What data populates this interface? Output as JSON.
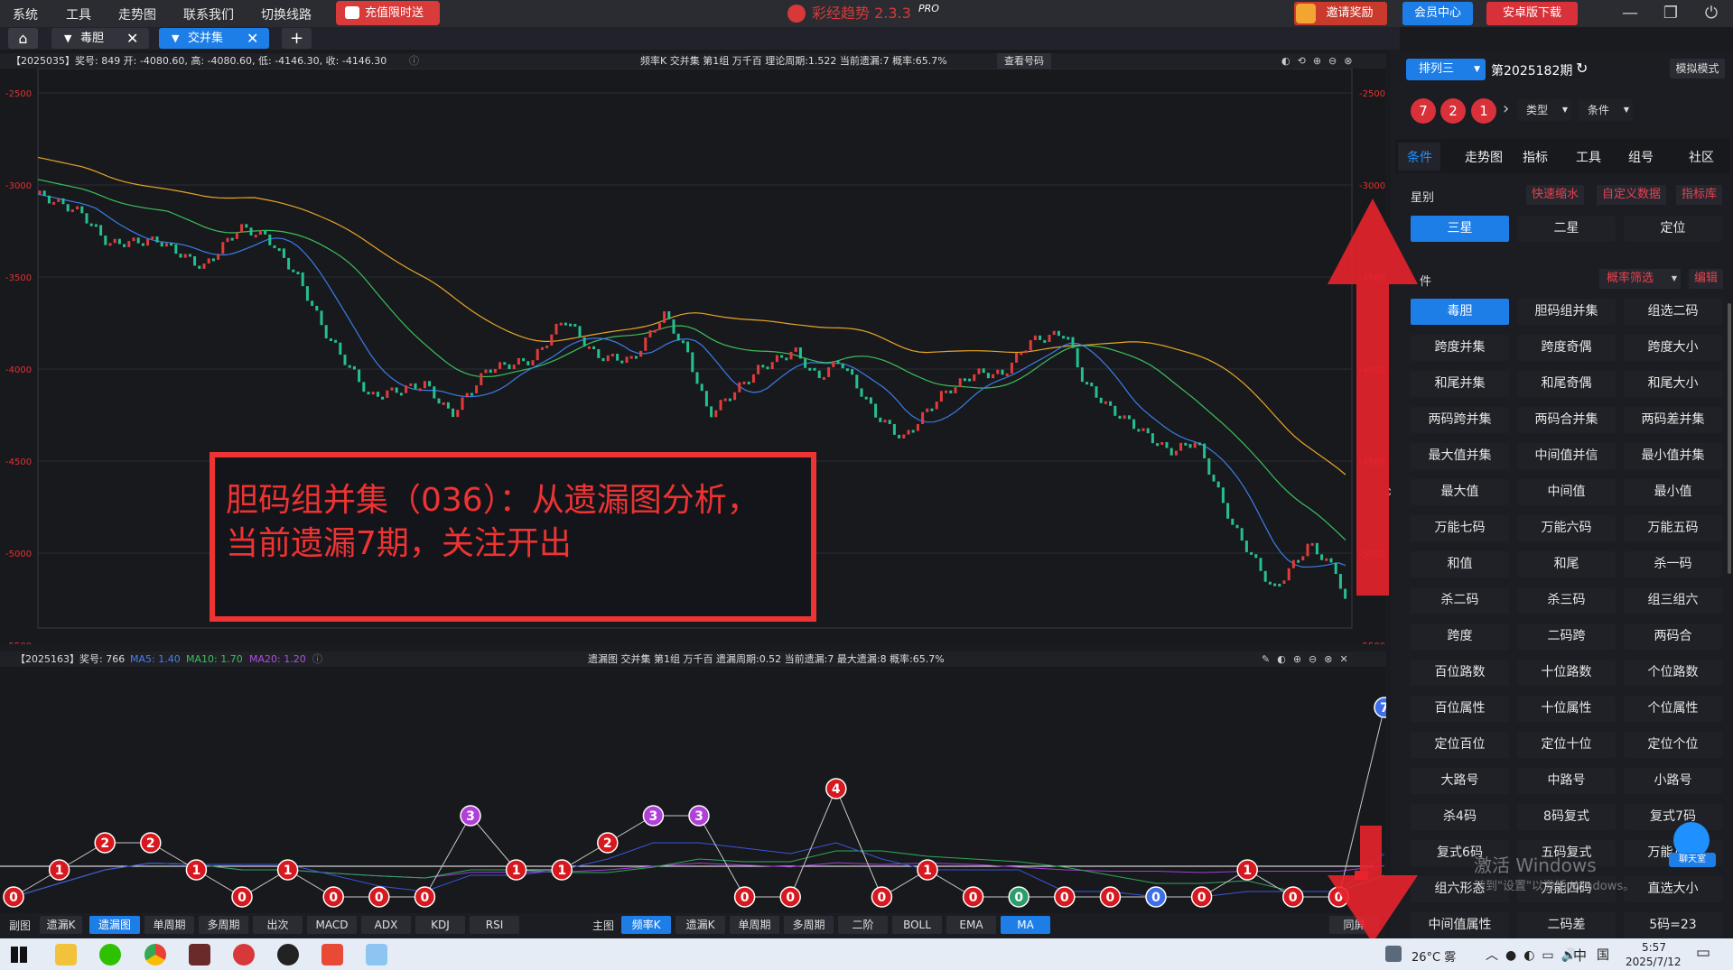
{
  "menu": {
    "items": [
      "系统",
      "工具",
      "走势图",
      "联系我们",
      "切换线路"
    ],
    "charge": "充值限时送"
  },
  "logo": {
    "title": "彩经趋势 2.3.3",
    "badge": "PRO"
  },
  "topbar": {
    "invite": "邀请奖励",
    "member": "会员中心",
    "android": "安卓版下载"
  },
  "tabs": [
    "毒胆",
    "交并集"
  ],
  "main_info": {
    "left": "【2025035】奖号: 849  开: -4080.60,  高: -4080.60,  低: -4146.30,  收: -4146.30",
    "center": "频率K  交并集  第1组  万千百  理论周期:1.522  当前遗漏:7  概率:65.7%",
    "button": "查看号码"
  },
  "sub_info": {
    "left": "【2025163】奖号: 766",
    "ma5": "MA5: 1.40",
    "ma10": "MA10: 1.70",
    "ma20": "MA20: 1.20",
    "center": "遗漏图  交并集  第1组  万千百  遗漏周期:0.52  当前遗漏:7  最大遗漏:8  概率:65.7%"
  },
  "annotation": {
    "line1": "胆码组并集（036）：从遗漏图分析，",
    "line2": "当前遗漏7期，关注开出"
  },
  "bottom_left": {
    "label": "副图",
    "buttons": [
      "遗漏K",
      "遗漏图",
      "单周期",
      "多周期",
      "出次",
      "MACD",
      "ADX",
      "KDJ",
      "RSI"
    ]
  },
  "bottom_right": {
    "label": "主图",
    "buttons": [
      "频率K",
      "遗漏K",
      "单周期",
      "多周期",
      "二阶",
      "BOLL",
      "EMA",
      "MA"
    ],
    "fullscreen": "同屏"
  },
  "right": {
    "lottery": "排列三",
    "period": "第2025182期",
    "mode": "模拟模式",
    "balls": [
      "7",
      "2",
      "1"
    ],
    "type_sel": "类型",
    "cond_sel": "条件",
    "nav": [
      "条件",
      "走势图",
      "指标",
      "工具",
      "组号",
      "社区"
    ],
    "star_label": "星别",
    "links": [
      "快速缩水",
      "自定义数据",
      "指标库"
    ],
    "stars": [
      "三星",
      "二星",
      "定位"
    ],
    "filter_label": "件",
    "prob_filter": "概率筛选",
    "edit": "编辑",
    "grid": [
      "毒胆",
      "胆码组并集",
      "组选二码",
      "跨度并集",
      "跨度奇偶",
      "跨度大小",
      "和尾并集",
      "和尾奇偶",
      "和尾大小",
      "两码跨并集",
      "两码合并集",
      "两码差并集",
      "最大值并集",
      "中间值并信",
      "最小值并集",
      "最大值",
      "中间值",
      "最小值",
      "万能七码",
      "万能六码",
      "万能五码",
      "和值",
      "和尾",
      "杀一码",
      "杀二码",
      "杀三码",
      "组三组六",
      "跨度",
      "二码跨",
      "两码合",
      "百位路数",
      "十位路数",
      "个位路数",
      "百位属性",
      "十位属性",
      "个位属性",
      "定位百位",
      "定位十位",
      "定位个位",
      "大路号",
      "中路号",
      "小路号",
      "杀4码",
      "8码复式",
      "复式7码",
      "复式6码",
      "五码复式",
      "万能八码",
      "组六形态",
      "万能四码",
      "直选大小",
      "中间值属性",
      "二码差",
      "5码=23"
    ],
    "chat": "聊天室"
  },
  "watermark": {
    "line1": "激活 Windows",
    "line2": "转到\"设置\"以激活 Windows。"
  },
  "axis": {
    "right": [
      "-2500",
      "-3000",
      "-3500",
      "-4000",
      "-4500",
      "-5000",
      "-5500"
    ]
  },
  "omission": [
    0,
    1,
    2,
    2,
    1,
    0,
    1,
    0,
    0,
    0,
    3,
    1,
    1,
    2,
    3,
    3,
    0,
    0,
    4,
    0,
    1,
    0,
    0,
    0,
    0,
    0,
    0,
    1,
    0,
    0,
    7
  ],
  "taskbar": {
    "weather": "26°C 雾",
    "ime": "中",
    "time": "5:57",
    "date": "2025/7/12"
  }
}
